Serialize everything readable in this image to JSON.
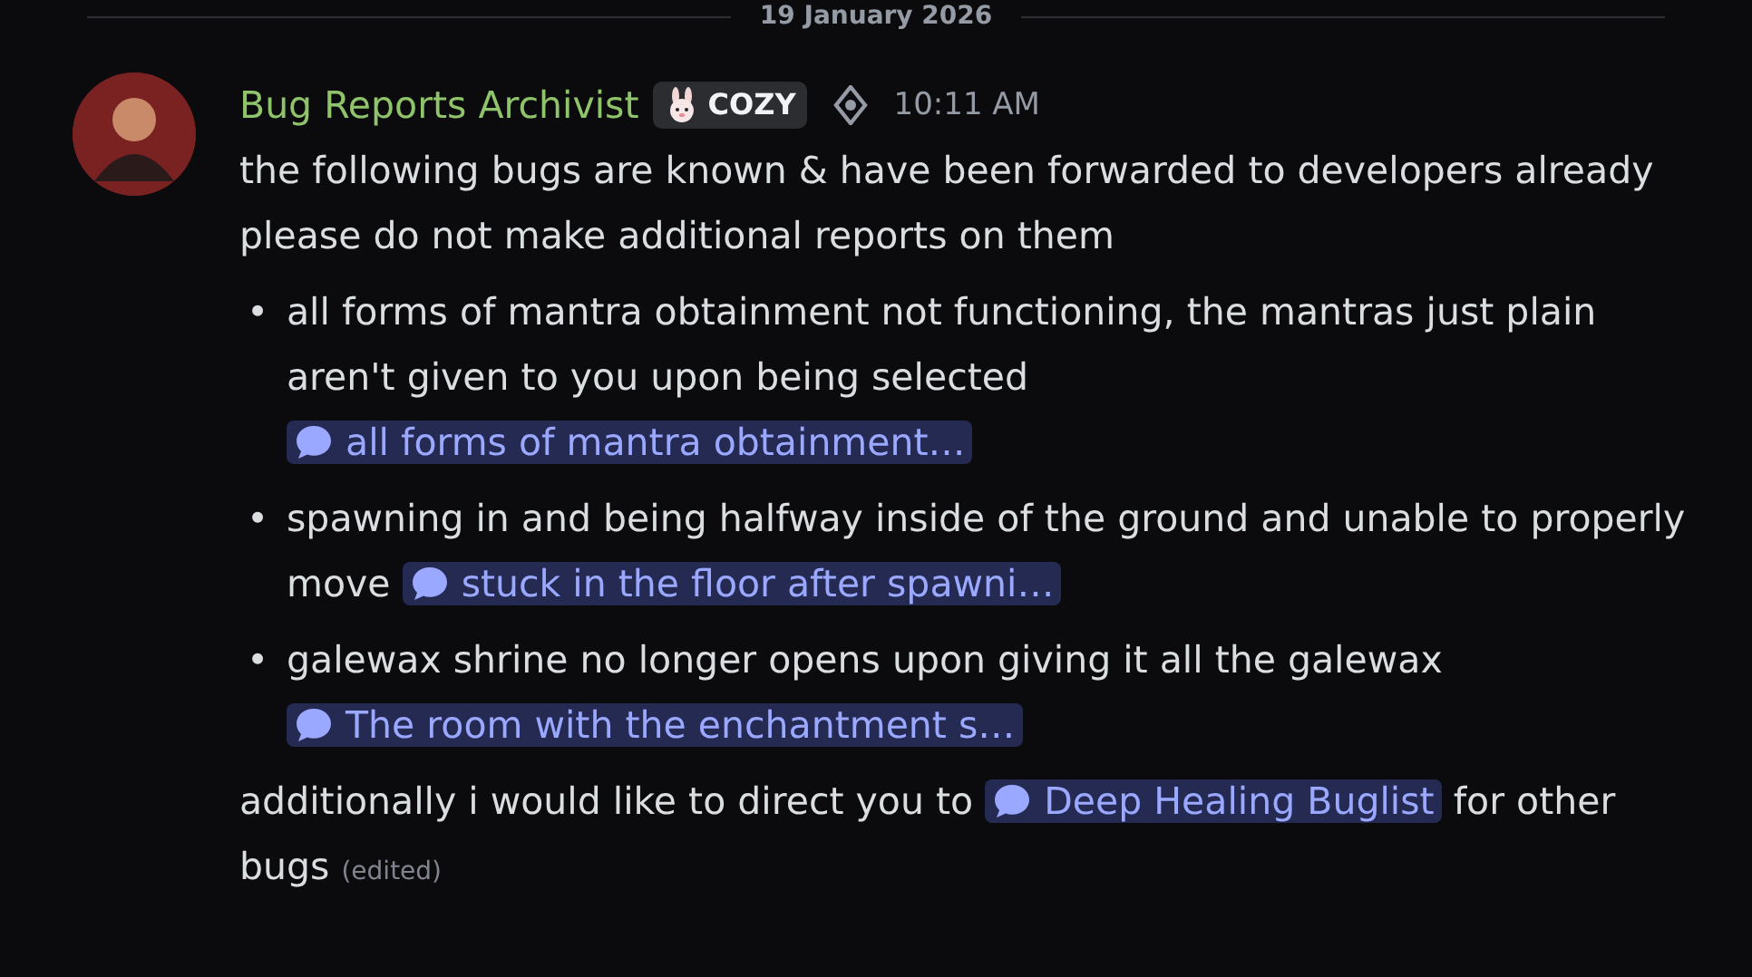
{
  "date_divider": "19 January 2026",
  "message": {
    "author": "Bug Reports Archivist",
    "tag": "COZY",
    "time": "10:11 AM",
    "lines": [
      "the following bugs are known & have been forwarded to developers already",
      "please do not make additional reports on them"
    ],
    "bullets": [
      {
        "marker": "•",
        "text": "all forms of mantra obtainment not functioning, the mantras just plain aren't given to you upon being selected",
        "thread": "all forms of mantra obtainment…"
      },
      {
        "marker": "•",
        "text": "spawning in and being halfway inside of the ground and unable to properly move",
        "thread": "stuck in the floor after spawni…"
      },
      {
        "marker": "•",
        "text": "galewax shrine no longer opens upon giving it all the galewax",
        "thread": "The room with the enchantment s…"
      }
    ],
    "closing": {
      "before": "additionally i would like to direct you to",
      "thread": "Deep Healing Buglist",
      "after": "for other bugs",
      "edited": "(edited)"
    }
  }
}
